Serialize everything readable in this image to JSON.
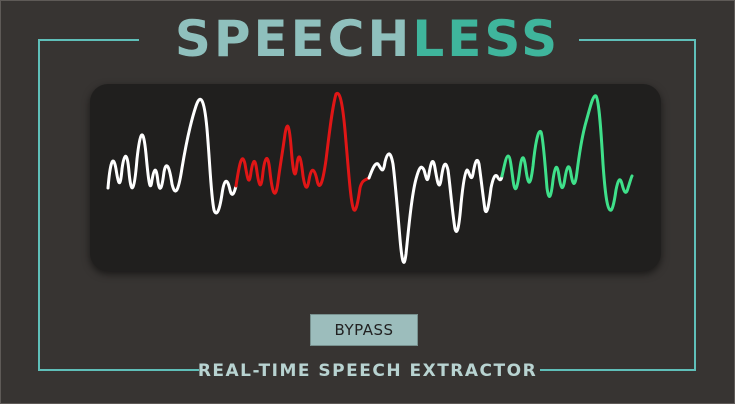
{
  "app": {
    "title_part1": "SPEECH",
    "title_part2": "LESS",
    "subtitle": "REAL-TIME SPEECH EXTRACTOR"
  },
  "controls": {
    "bypass_label": "BYPASS"
  },
  "colors": {
    "background": "#373432",
    "frame": "#5fbfb9",
    "display": "#201f1e",
    "title_light": "#8fc0bd",
    "title_accent": "#3fb59c",
    "wave_normal": "#ffffff",
    "wave_noise": "#e01616",
    "wave_speech": "#3fe08a",
    "button": "#9cbdbc"
  },
  "waveform": {
    "segments": [
      {
        "name": "speech-segment-1",
        "color": "wave_normal"
      },
      {
        "name": "noise-segment",
        "color": "wave_noise"
      },
      {
        "name": "speech-segment-2",
        "color": "wave_normal"
      },
      {
        "name": "extracted-speech-segment",
        "color": "wave_speech"
      }
    ]
  }
}
